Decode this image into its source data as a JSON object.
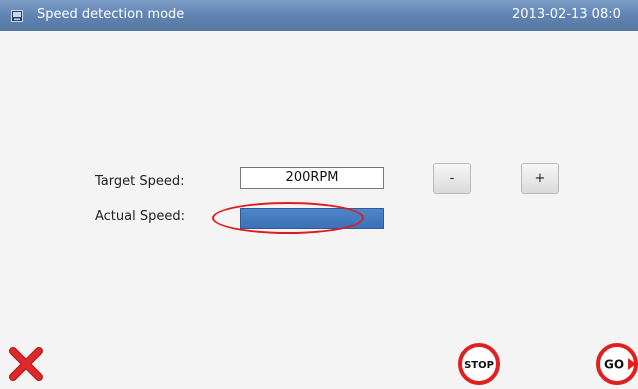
{
  "header": {
    "icon": "screen-icon",
    "title": "Speed detection mode",
    "clock": "2013-02-13 08:0"
  },
  "form": {
    "target_label": "Target Speed:",
    "target_value": "200RPM",
    "actual_label": "Actual Speed:",
    "actual_value": "",
    "decrease_label": "-",
    "increase_label": "+"
  },
  "footer": {
    "close_icon": "red-x-icon",
    "stop_label": "STOP",
    "go_label": "GO"
  },
  "colors": {
    "titlebar": "#5f82b2",
    "actual_speed_bar": "#4479be",
    "highlight_ring": "#e01b1b",
    "stop_ring": "#e02020",
    "close_x": "#e0282b"
  }
}
